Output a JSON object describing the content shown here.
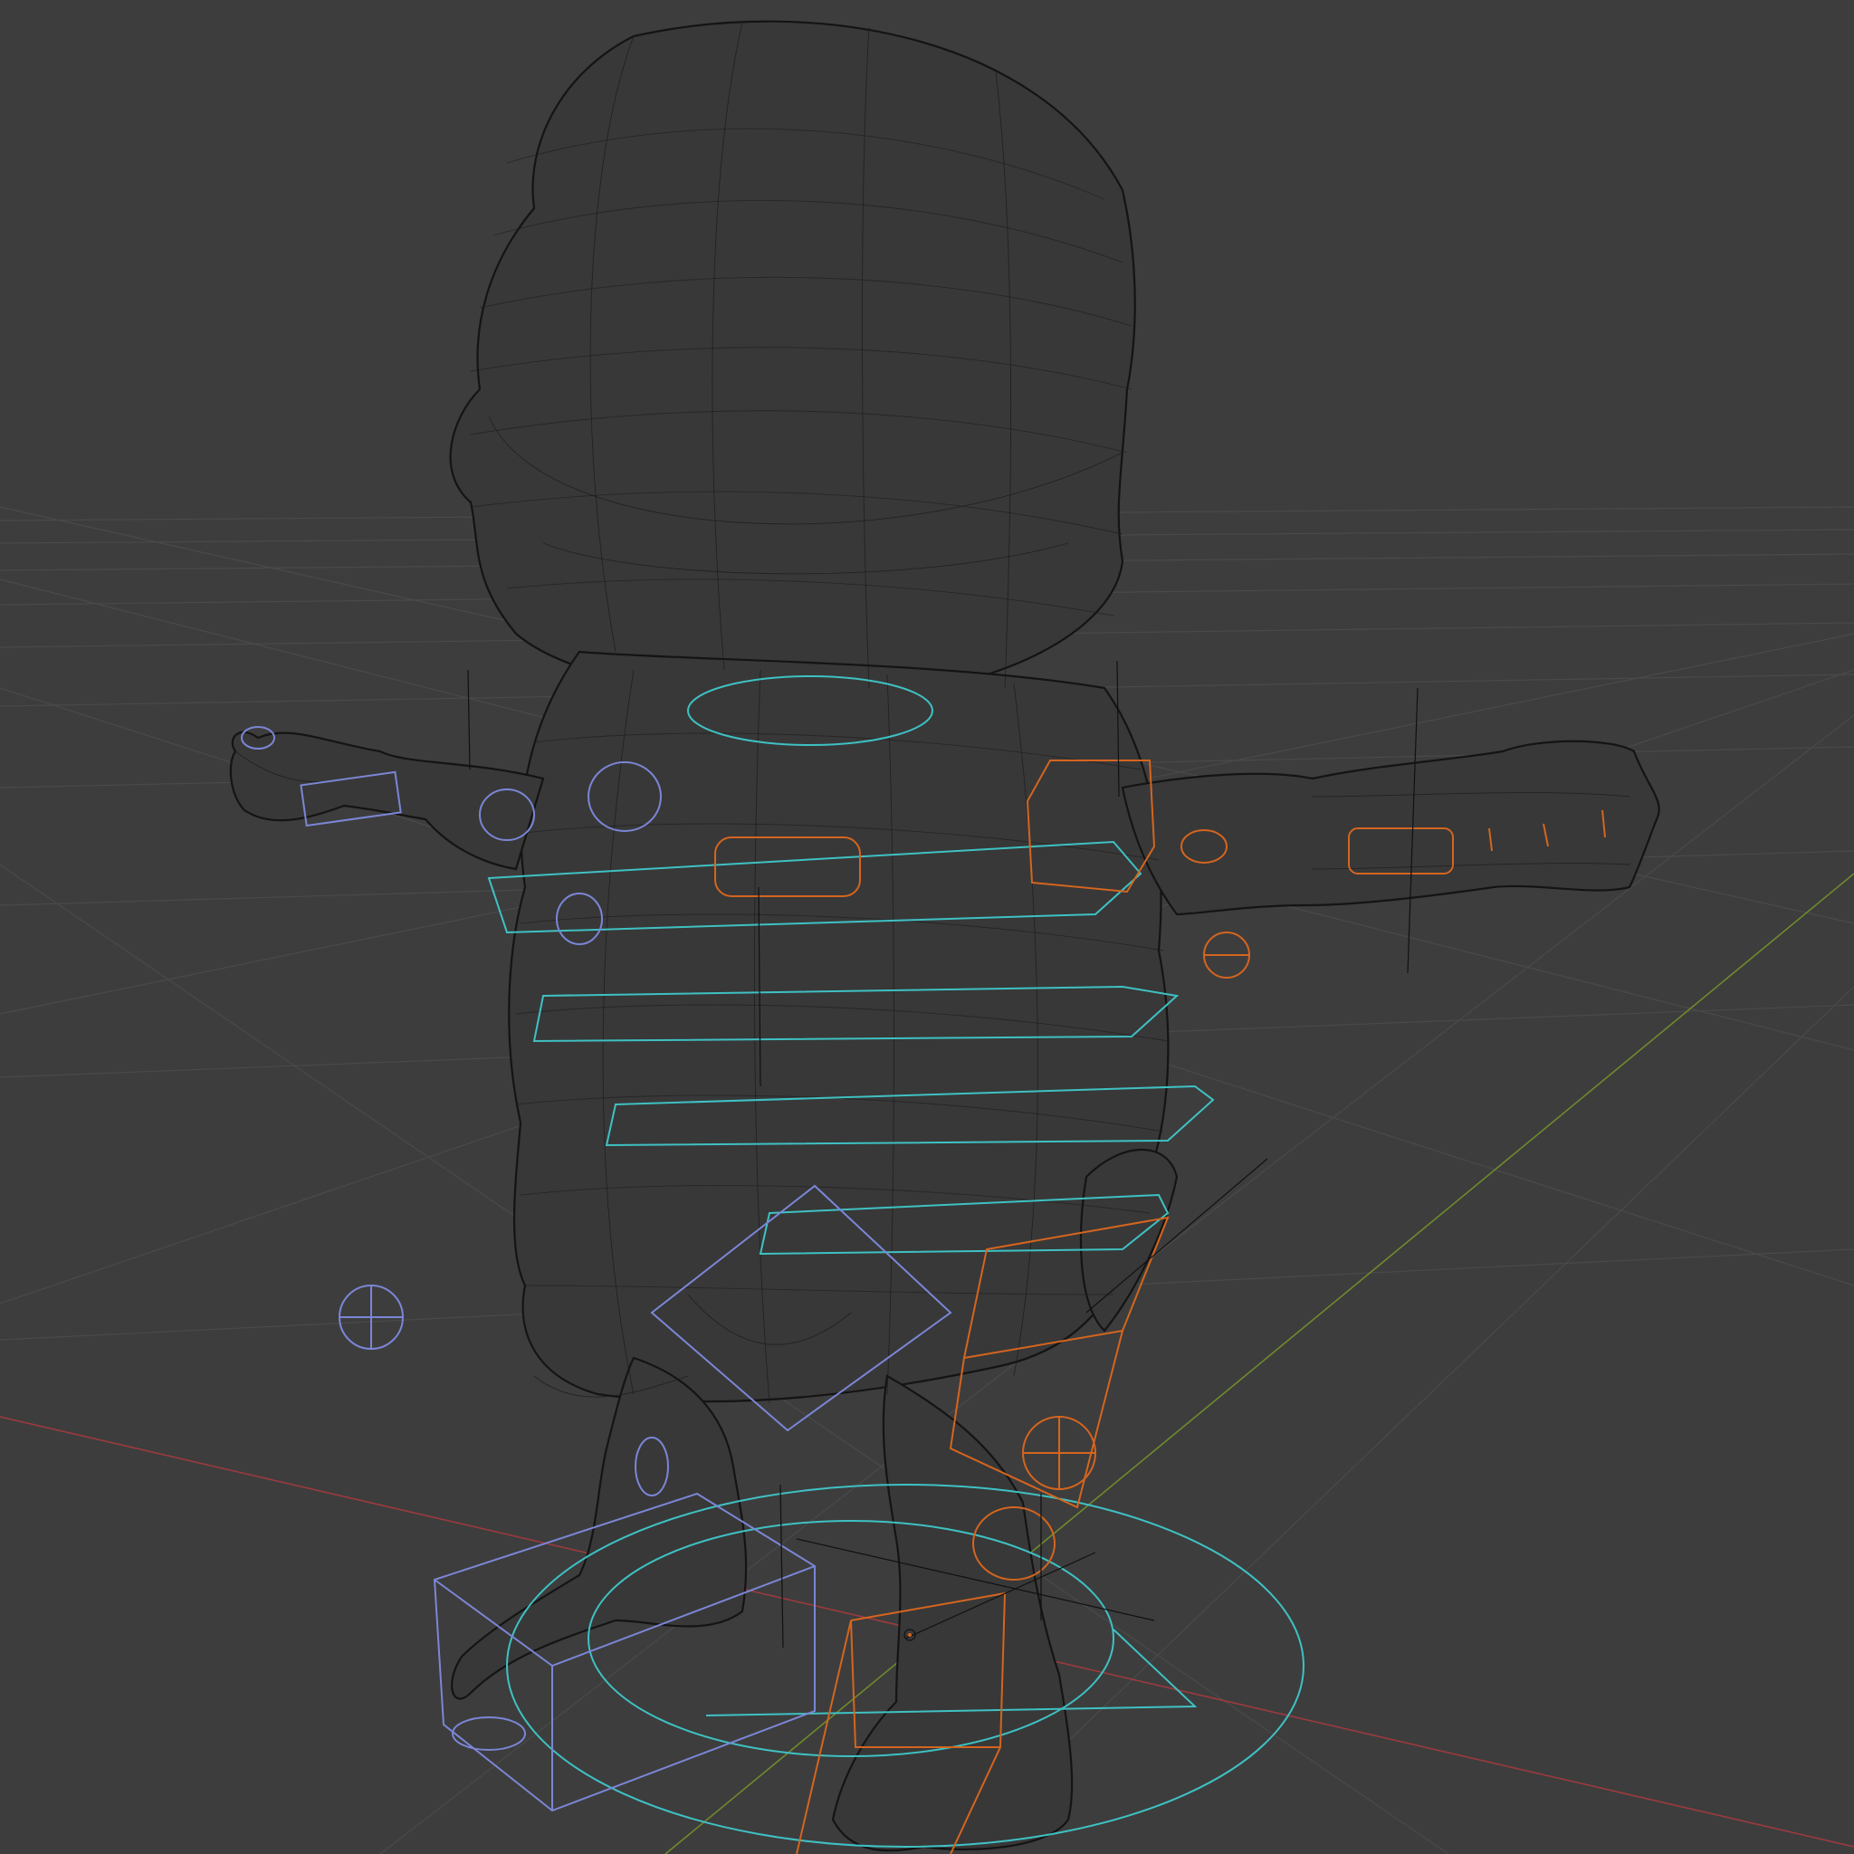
{
  "viewport": {
    "background": "#3d3d3d",
    "shading_mode": "wireframe",
    "grid_color": "#4a4a4a",
    "axis_x_color": "#9b3b3e",
    "axis_y_color": "#6f8a2c"
  },
  "rig": {
    "mesh_wire_color": "#1b1b1b",
    "control_colors": {
      "center": "#3fc1c4",
      "left": "#7b86d6",
      "right": "#d4651f"
    }
  }
}
